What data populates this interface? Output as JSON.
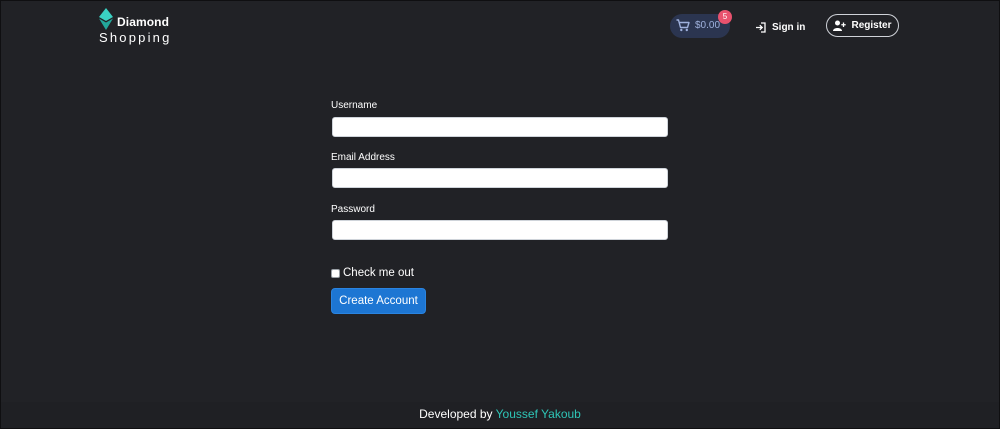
{
  "brand": {
    "line1": "Diamond",
    "line2": "Shopping"
  },
  "cart": {
    "total": "$0.00",
    "count": "5"
  },
  "nav": {
    "signin_label": "Sign in",
    "register_label": "Register"
  },
  "form": {
    "username_label": "Username",
    "username_value": "",
    "email_label": "Email Address",
    "email_value": "",
    "password_label": "Password",
    "password_value": "",
    "check_label": "Check me out",
    "submit_label": "Create Account"
  },
  "footer": {
    "prefix": "Developed by",
    "author": "Youssef Yakoub"
  },
  "colors": {
    "accent": "#2ec4b6",
    "primary_button": "#1d76d3",
    "badge": "#e8526e",
    "background": "#212226"
  },
  "icons": {
    "logo": "diamond-icon",
    "cart": "cart-icon",
    "signin": "sign-in-icon",
    "register": "user-plus-icon"
  }
}
